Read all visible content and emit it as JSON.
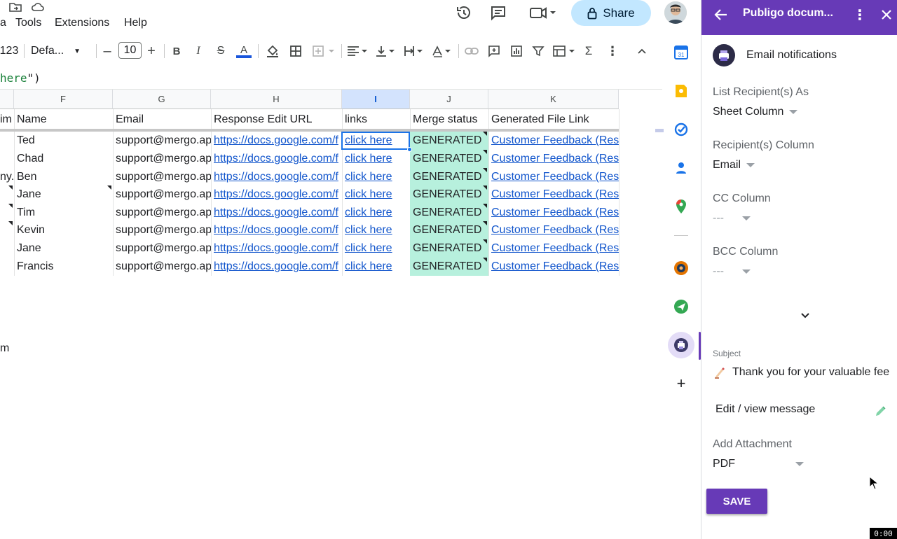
{
  "menu": {
    "items": [
      "a",
      "Tools",
      "Extensions",
      "Help"
    ]
  },
  "header": {
    "share_label": "Share"
  },
  "toolbar": {
    "num_format": "123",
    "font": "Defa...",
    "font_size": "10"
  },
  "formula": {
    "prefix": "here",
    "suffix": "\")"
  },
  "grid": {
    "columns": [
      {
        "label": "F",
        "selected": false
      },
      {
        "label": "G",
        "selected": false
      },
      {
        "label": "H",
        "selected": false
      },
      {
        "label": "I",
        "selected": true
      },
      {
        "label": "J",
        "selected": false
      },
      {
        "label": "K",
        "selected": false
      }
    ],
    "headers": {
      "left_fragment": "im",
      "name": "Name",
      "email": "Email",
      "edit_url": "Response Edit URL",
      "links": "links",
      "merge_status": "Merge status",
      "file_link": "Generated File Link"
    },
    "rows": [
      {
        "left_fragment": "",
        "name": "Ted",
        "email": "support@mergo.ap",
        "url": "https://docs.google.com/f",
        "link": "click here",
        "status": "GENERATED",
        "file": "Customer Feedback (Res"
      },
      {
        "left_fragment": "",
        "name": "Chad",
        "email": "support@mergo.ap",
        "url": "https://docs.google.com/f",
        "link": "click here",
        "status": "GENERATED",
        "file": "Customer Feedback (Res"
      },
      {
        "left_fragment": "ny.",
        "name": "Ben",
        "email": "support@mergo.ap",
        "url": "https://docs.google.com/f",
        "link": "click here",
        "status": "GENERATED",
        "file": "Customer Feedback (Res"
      },
      {
        "left_fragment": "",
        "name": "Jane",
        "email": "support@mergo.ap",
        "url": "https://docs.google.com/f",
        "link": "click here",
        "status": "GENERATED",
        "file": "Customer Feedback (Res"
      },
      {
        "left_fragment": "",
        "name": "Tim",
        "email": "support@mergo.ap",
        "url": "https://docs.google.com/f",
        "link": "click here",
        "status": "GENERATED",
        "file": "Customer Feedback (Res"
      },
      {
        "left_fragment": "",
        "name": "Kevin",
        "email": "support@mergo.ap",
        "url": "https://docs.google.com/f",
        "link": "click here",
        "status": "GENERATED",
        "file": "Customer Feedback (Res"
      },
      {
        "left_fragment": "",
        "name": "Jane",
        "email": "support@mergo.ap",
        "url": "https://docs.google.com/f",
        "link": "click here",
        "status": "GENERATED",
        "file": "Customer Feedback (Res"
      },
      {
        "left_fragment": "",
        "name": "Francis",
        "email": "support@mergo.ap",
        "url": "https://docs.google.com/f",
        "link": "click here",
        "status": "GENERATED",
        "file": "Customer Feedback (Res"
      }
    ],
    "stray_text": "m"
  },
  "panel": {
    "title": "Publigo docum...",
    "section_title": "Email notifications",
    "list_recipients_label": "List Recipient(s) As",
    "list_recipients_value": "Sheet Column",
    "recipient_column_label": "Recipient(s) Column",
    "recipient_column_value": "Email",
    "cc_label": "CC Column",
    "cc_value": "---",
    "bcc_label": "BCC Column",
    "bcc_value": "---",
    "subject_label": "Subject",
    "subject_value": "Thank you for your valuable fee",
    "edit_message": "Edit / view message",
    "attachment_label": "Add Attachment",
    "attachment_value": "PDF",
    "save_label": "SAVE"
  },
  "timer": "0:00",
  "colors": {
    "panel_accent": "#673ab7",
    "merge_fill": "#b7f0dd",
    "link": "#1155cc",
    "share_bg": "#c2e7ff"
  }
}
